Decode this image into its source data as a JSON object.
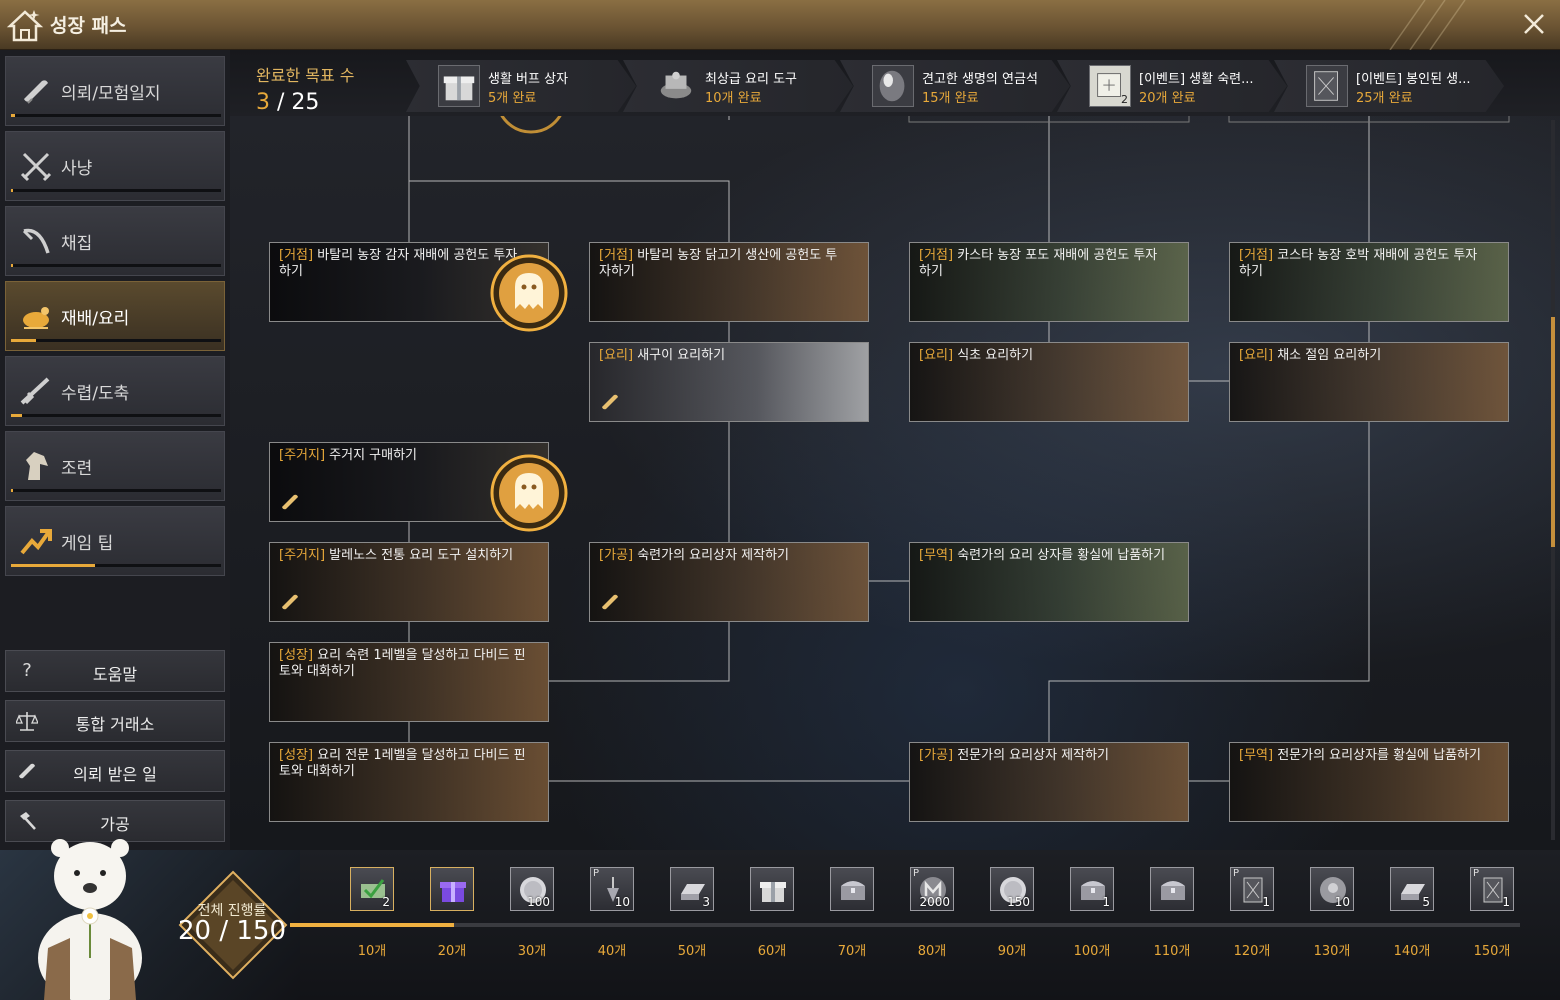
{
  "window": {
    "title": "성장 패스"
  },
  "sidebar": {
    "categories": [
      {
        "label": "의뢰/모험일지",
        "progress": 0.0
      },
      {
        "label": "사냥",
        "progress": 0.0
      },
      {
        "label": "채집",
        "progress": 0.0
      },
      {
        "label": "재배/요리",
        "progress": 0.12,
        "active": true
      },
      {
        "label": "수렵/도축",
        "progress": 0.05
      },
      {
        "label": "조련",
        "progress": 0.0
      },
      {
        "label": "게임 팁",
        "progress": 0.4
      }
    ],
    "utilities": [
      {
        "label": "도움말",
        "icon": "?"
      },
      {
        "label": "통합 거래소",
        "icon": "scale-icon"
      },
      {
        "label": "의뢰 받은 일",
        "icon": "scroll-icon"
      },
      {
        "label": "가공",
        "icon": "hammer-icon"
      }
    ]
  },
  "header": {
    "completed_label": "완료한 목표 수",
    "completed_current": "3",
    "completed_separator": " / ",
    "completed_total": "25",
    "milestones": [
      {
        "name": "생활 버프 상자",
        "req": "5개 완료",
        "icon": "gift-box-icon",
        "qty": ""
      },
      {
        "name": "최상급 요리 도구",
        "req": "10개 완료",
        "icon": "cooking-tool-icon",
        "qty": ""
      },
      {
        "name": "견고한 생명의 연금석",
        "req": "15개 완료",
        "icon": "alchemy-stone-icon",
        "qty": ""
      },
      {
        "name": "[이벤트] 생활 숙련...",
        "req": "20개 완료",
        "icon": "scroll-map-icon",
        "qty": "2"
      },
      {
        "name": "[이벤트] 봉인된 생...",
        "req": "25개 완료",
        "icon": "sealed-book-icon",
        "qty": ""
      }
    ]
  },
  "quests": [
    {
      "tag": "[거점]",
      "text": " 바탈리 농장 감자 재배에 공헌도 투자하기",
      "medal": true,
      "scroll": false,
      "tone": ""
    },
    {
      "tag": "[거점]",
      "text": " 바탈리 농장 닭고기 생산에 공헌도 투자하기",
      "medal": false,
      "scroll": false,
      "tone": "warm"
    },
    {
      "tag": "[거점]",
      "text": " 카스타 농장 포도 재배에 공헌도 투자하기",
      "medal": false,
      "scroll": false,
      "tone": "green"
    },
    {
      "tag": "[거점]",
      "text": " 코스타 농장 호박 재배에 공헌도 투자하기",
      "medal": false,
      "scroll": false,
      "tone": "green"
    },
    {
      "tag": "[요리]",
      "text": " 새구이 요리하기",
      "medal": false,
      "scroll": true,
      "tone": "light"
    },
    {
      "tag": "[요리]",
      "text": " 식초 요리하기",
      "medal": false,
      "scroll": false,
      "tone": "warm"
    },
    {
      "tag": "[요리]",
      "text": " 채소 절임 요리하기",
      "medal": false,
      "scroll": false,
      "tone": "warm"
    },
    {
      "tag": "[주거지]",
      "text": " 주거지 구매하기",
      "medal": true,
      "scroll": true,
      "tone": ""
    },
    {
      "tag": "[주거지]",
      "text": " 발레노스 전통 요리 도구 설치하기",
      "medal": false,
      "scroll": true,
      "tone": "warm"
    },
    {
      "tag": "[가공]",
      "text": " 숙련가의 요리상자 제작하기",
      "medal": false,
      "scroll": true,
      "tone": "warm"
    },
    {
      "tag": "[무역]",
      "text": " 숙련가의 요리 상자를 황실에 납품하기",
      "medal": false,
      "scroll": false,
      "tone": "green"
    },
    {
      "tag": "[성장]",
      "text": " 요리 숙련 1레벨을 달성하고 다비드 핀토와 대화하기",
      "medal": false,
      "scroll": false,
      "tone": "warm"
    },
    {
      "tag": "[성장]",
      "text": " 요리 전문 1레벨을 달성하고 다비드 핀토와 대화하기",
      "medal": false,
      "scroll": false,
      "tone": "warm"
    },
    {
      "tag": "[가공]",
      "text": " 전문가의 요리상자 제작하기",
      "medal": false,
      "scroll": false,
      "tone": "warm"
    },
    {
      "tag": "[무역]",
      "text": " 전문가의 요리상자를 황실에 납품하기",
      "medal": false,
      "scroll": false,
      "tone": "warm"
    }
  ],
  "footer": {
    "total_label": "전체 진행률",
    "total_current": "20",
    "total_separator": " / ",
    "total_max": "150",
    "progress": 0.1333,
    "rewards": [
      {
        "label": "10개",
        "qty": "2",
        "icon": "check-voucher-icon",
        "p": false,
        "done": true
      },
      {
        "label": "20개",
        "qty": "",
        "icon": "purple-gift-icon",
        "p": false,
        "done": true
      },
      {
        "label": "30개",
        "qty": "100",
        "icon": "silver-coin-icon",
        "p": false,
        "done": false
      },
      {
        "label": "40개",
        "qty": "10",
        "icon": "pendant-icon",
        "p": true,
        "done": false
      },
      {
        "label": "50개",
        "qty": "3",
        "icon": "silver-ingot-icon",
        "p": false,
        "done": false
      },
      {
        "label": "60개",
        "qty": "",
        "icon": "gift-box-icon",
        "p": false,
        "done": false
      },
      {
        "label": "70개",
        "qty": "",
        "icon": "chest-icon",
        "p": false,
        "done": false
      },
      {
        "label": "80개",
        "qty": "2000",
        "icon": "m-coin-icon",
        "p": true,
        "done": false
      },
      {
        "label": "90개",
        "qty": "150",
        "icon": "silver-coin-icon",
        "p": false,
        "done": false
      },
      {
        "label": "100개",
        "qty": "1",
        "icon": "chest-icon",
        "p": false,
        "done": false
      },
      {
        "label": "110개",
        "qty": "",
        "icon": "chest-icon",
        "p": false,
        "done": false
      },
      {
        "label": "120개",
        "qty": "1",
        "icon": "sealed-book-icon",
        "p": true,
        "done": false
      },
      {
        "label": "130개",
        "qty": "10",
        "icon": "coin-face-icon",
        "p": false,
        "done": false
      },
      {
        "label": "140개",
        "qty": "5",
        "icon": "silver-ingot-icon",
        "p": false,
        "done": false
      },
      {
        "label": "150개",
        "qty": "1",
        "icon": "sealed-book-icon",
        "p": true,
        "done": false
      }
    ]
  },
  "colors": {
    "accent": "#e8a93a",
    "title_bar": "#6b5433",
    "card_border": "#8a8a8a"
  }
}
